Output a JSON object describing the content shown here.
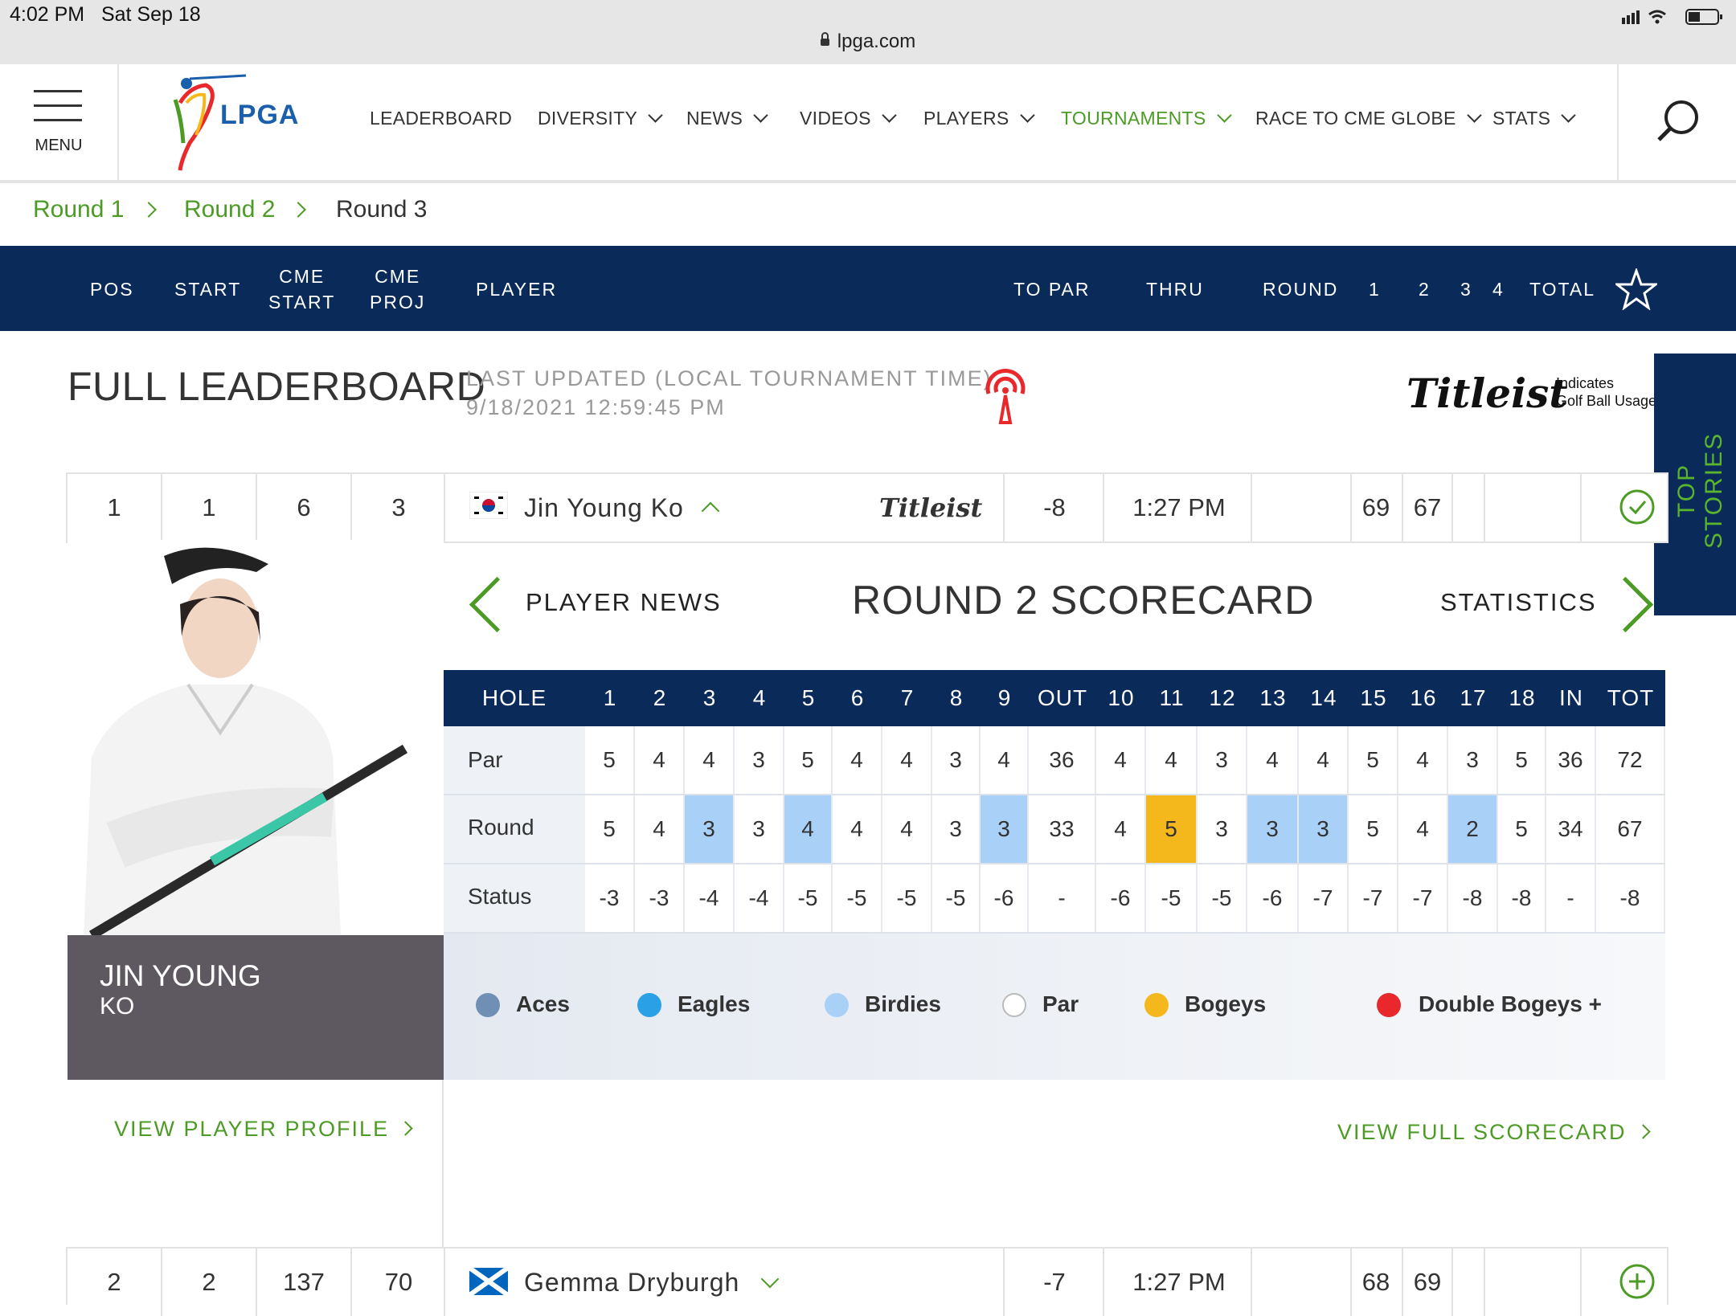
{
  "status_bar": {
    "time": "4:02 PM",
    "date": "Sat Sep 18"
  },
  "browser": {
    "url": "lpga.com"
  },
  "nav": {
    "menu_label": "MENU",
    "logo_text": "LPGA",
    "items": [
      {
        "label": "LEADERBOARD"
      },
      {
        "label": "DIVERSITY"
      },
      {
        "label": "NEWS"
      },
      {
        "label": "VIDEOS"
      },
      {
        "label": "PLAYERS"
      },
      {
        "label": "TOURNAMENTS"
      },
      {
        "label": "RACE TO CME GLOBE"
      },
      {
        "label": "STATS"
      }
    ]
  },
  "breadcrumb": [
    "Round 1",
    "Round 2",
    "Round 3"
  ],
  "header": {
    "pos": "POS",
    "start": "START",
    "cme_start_1": "CME",
    "cme_start_2": "START",
    "cme_proj_1": "CME",
    "cme_proj_2": "PROJ",
    "player": "PLAYER",
    "to_par": "TO PAR",
    "thru": "THRU",
    "round": "ROUND",
    "r1": "1",
    "r2": "2",
    "r3": "3",
    "r4": "4",
    "total": "TOTAL"
  },
  "title": {
    "full_leaderboard": "FULL LEADERBOARD",
    "last_updated_label": "LAST UPDATED (LOCAL TOURNAMENT TIME)",
    "last_updated_time": "9/18/2021 12:59:45 PM",
    "sponsor_logo": "Titleist",
    "sponsor_note_1": "Indicates",
    "sponsor_note_2": "Golf Ball Usage"
  },
  "top_stories": "TOP STORIES",
  "players": [
    {
      "pos": "1",
      "start": "1",
      "cme_start": "6",
      "cme_proj": "3",
      "name": "Jin Young Ko",
      "ball": "Titleist",
      "to_par": "-8",
      "thru": "1:27 PM",
      "r1": "69",
      "r2": "67"
    },
    {
      "pos": "2",
      "start": "2",
      "cme_start": "137",
      "cme_proj": "70",
      "name": "Gemma Dryburgh",
      "to_par": "-7",
      "thru": "1:27 PM",
      "r1": "68",
      "r2": "69"
    }
  ],
  "expanded": {
    "first_name": "JIN YOUNG",
    "last_name": "KO",
    "player_news": "PLAYER NEWS",
    "scorecard_title": "ROUND 2 SCORECARD",
    "statistics": "STATISTICS",
    "view_profile": "VIEW PLAYER PROFILE",
    "view_full_scorecard": "VIEW FULL SCORECARD"
  },
  "scorecard": {
    "hole_label": "HOLE",
    "columns": [
      "1",
      "2",
      "3",
      "4",
      "5",
      "6",
      "7",
      "8",
      "9",
      "OUT",
      "10",
      "11",
      "12",
      "13",
      "14",
      "15",
      "16",
      "17",
      "18",
      "IN",
      "TOT"
    ],
    "rows": [
      {
        "label": "Par",
        "values": [
          "5",
          "4",
          "4",
          "3",
          "5",
          "4",
          "4",
          "3",
          "4",
          "36",
          "4",
          "4",
          "3",
          "4",
          "4",
          "5",
          "4",
          "3",
          "5",
          "36",
          "72"
        ]
      },
      {
        "label": "Round",
        "values": [
          "5",
          "4",
          "3",
          "3",
          "4",
          "4",
          "4",
          "3",
          "3",
          "33",
          "4",
          "5",
          "3",
          "3",
          "3",
          "5",
          "4",
          "2",
          "5",
          "34",
          "67"
        ],
        "results": [
          "par",
          "par",
          "birdie",
          "par",
          "birdie",
          "par",
          "par",
          "par",
          "birdie",
          "",
          "par",
          "bogey",
          "par",
          "birdie",
          "birdie",
          "par",
          "par",
          "birdie",
          "par",
          "",
          ""
        ]
      },
      {
        "label": "Status",
        "values": [
          "-3",
          "-3",
          "-4",
          "-4",
          "-5",
          "-5",
          "-5",
          "-5",
          "-6",
          "-",
          "-6",
          "-5",
          "-5",
          "-6",
          "-7",
          "-7",
          "-7",
          "-8",
          "-8",
          "-",
          "-8"
        ]
      }
    ]
  },
  "legend": [
    {
      "label": "Aces",
      "color": "#6f8fb5"
    },
    {
      "label": "Eagles",
      "color": "#2aa0e6"
    },
    {
      "label": "Birdies",
      "color": "#a9d1f7"
    },
    {
      "label": "Par",
      "color": "#ffffff"
    },
    {
      "label": "Bogeys",
      "color": "#f5b81c"
    },
    {
      "label": "Double Bogeys +",
      "color": "#e8282b"
    }
  ],
  "colors": {
    "navy": "#0a2a5a",
    "green": "#4c9b25",
    "birdie": "#a9d1f7",
    "bogey": "#f5b81c"
  }
}
